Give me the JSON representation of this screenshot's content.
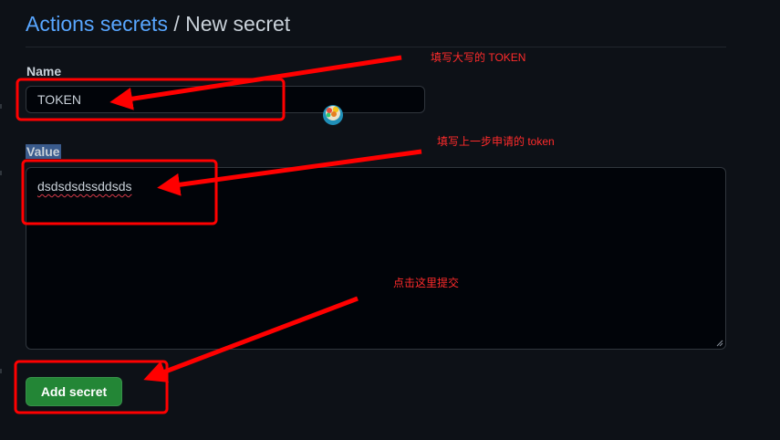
{
  "header": {
    "breadcrumb_link": "Actions secrets",
    "separator": " / ",
    "current": "New secret"
  },
  "form": {
    "name_label": "Name",
    "name_value": "TOKEN",
    "value_label": "Value",
    "value_text": "dsdsdsdssddsds",
    "submit_label": "Add secret"
  },
  "annotations": {
    "name_note": "填写大写的 TOKEN",
    "value_note": "填写上一步申请的 token",
    "submit_note": "点击这里提交"
  },
  "colors": {
    "background": "#0d1117",
    "link": "#58a6ff",
    "button": "#238636",
    "annotation": "#ff2b2b"
  }
}
